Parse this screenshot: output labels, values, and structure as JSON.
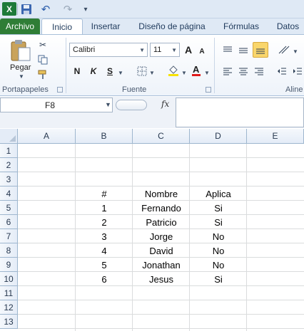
{
  "qat": {
    "logo_letter": "X",
    "undo_glyph": "↶",
    "redo_glyph": "↷",
    "more_glyph": "▾"
  },
  "tabs": [
    {
      "label": "Archivo"
    },
    {
      "label": "Inicio"
    },
    {
      "label": "Insertar"
    },
    {
      "label": "Diseño de página"
    },
    {
      "label": "Fórmulas"
    },
    {
      "label": "Datos"
    }
  ],
  "ribbon": {
    "clipboard": {
      "paste_label": "Pegar",
      "group_label": "Portapapeles"
    },
    "font": {
      "name": "Calibri",
      "size": "11",
      "grow_label": "A",
      "shrink_label": "A",
      "bold": "N",
      "italic": "K",
      "underline": "S",
      "group_label": "Fuente"
    },
    "alignment": {
      "group_label": "Aline"
    }
  },
  "formula_bar": {
    "name_box": "F8",
    "fx": "fx",
    "formula": ""
  },
  "sheet": {
    "columns": [
      "A",
      "B",
      "C",
      "D",
      "E"
    ],
    "rows": [
      "1",
      "2",
      "3",
      "4",
      "5",
      "6",
      "7",
      "8",
      "9",
      "10",
      "11",
      "12",
      "13"
    ],
    "table": {
      "header": {
        "num": "#",
        "name": "Nombre",
        "applies": "Aplica"
      },
      "records": [
        {
          "num": "1",
          "name": "Fernando",
          "applies": "Si"
        },
        {
          "num": "2",
          "name": "Patricio",
          "applies": "Si"
        },
        {
          "num": "3",
          "name": "Jorge",
          "applies": "No"
        },
        {
          "num": "4",
          "name": "David",
          "applies": "No"
        },
        {
          "num": "5",
          "name": "Jonathan",
          "applies": "No"
        },
        {
          "num": "6",
          "name": "Jesus",
          "applies": "Si"
        }
      ]
    }
  },
  "colors": {
    "file_tab": "#2f7d36",
    "excel_logo": "#1d7a3a",
    "selected_align": "#f9d66b"
  }
}
